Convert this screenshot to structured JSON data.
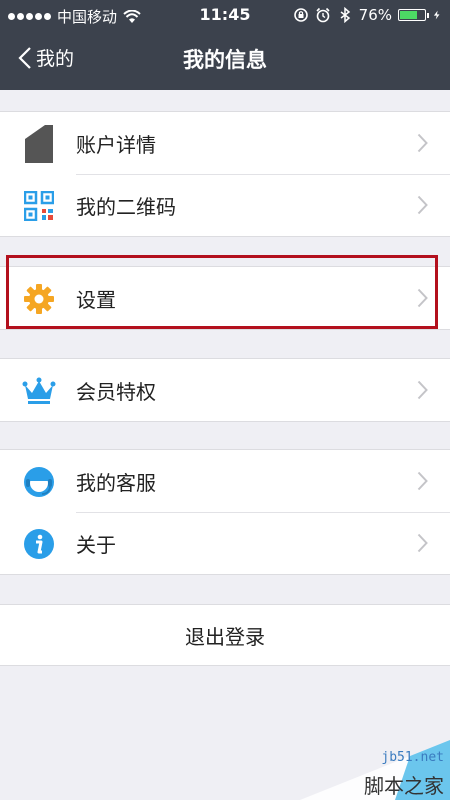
{
  "status_bar": {
    "carrier": "中国移动",
    "time": "11:45",
    "battery_percent": "76%",
    "battery_level": 0.76
  },
  "nav": {
    "back_label": "我的",
    "title": "我的信息"
  },
  "groups": [
    {
      "items": [
        {
          "label": "账户详情",
          "icon": "account-icon"
        },
        {
          "label": "我的二维码",
          "icon": "qr-code-icon"
        }
      ]
    },
    {
      "items": [
        {
          "label": "设置",
          "icon": "gear-icon"
        }
      ]
    },
    {
      "items": [
        {
          "label": "会员特权",
          "icon": "crown-icon"
        }
      ]
    },
    {
      "items": [
        {
          "label": "我的客服",
          "icon": "customer-service-icon"
        },
        {
          "label": "关于",
          "icon": "info-icon"
        }
      ]
    }
  ],
  "logout_label": "退出登录",
  "watermark": {
    "site": "jb51.net",
    "name": "脚本之家"
  },
  "colors": {
    "nav_bg": "#3c424d",
    "highlight_border": "#b3101d",
    "gear": "#f5a623",
    "blue": "#2a9ee8"
  }
}
